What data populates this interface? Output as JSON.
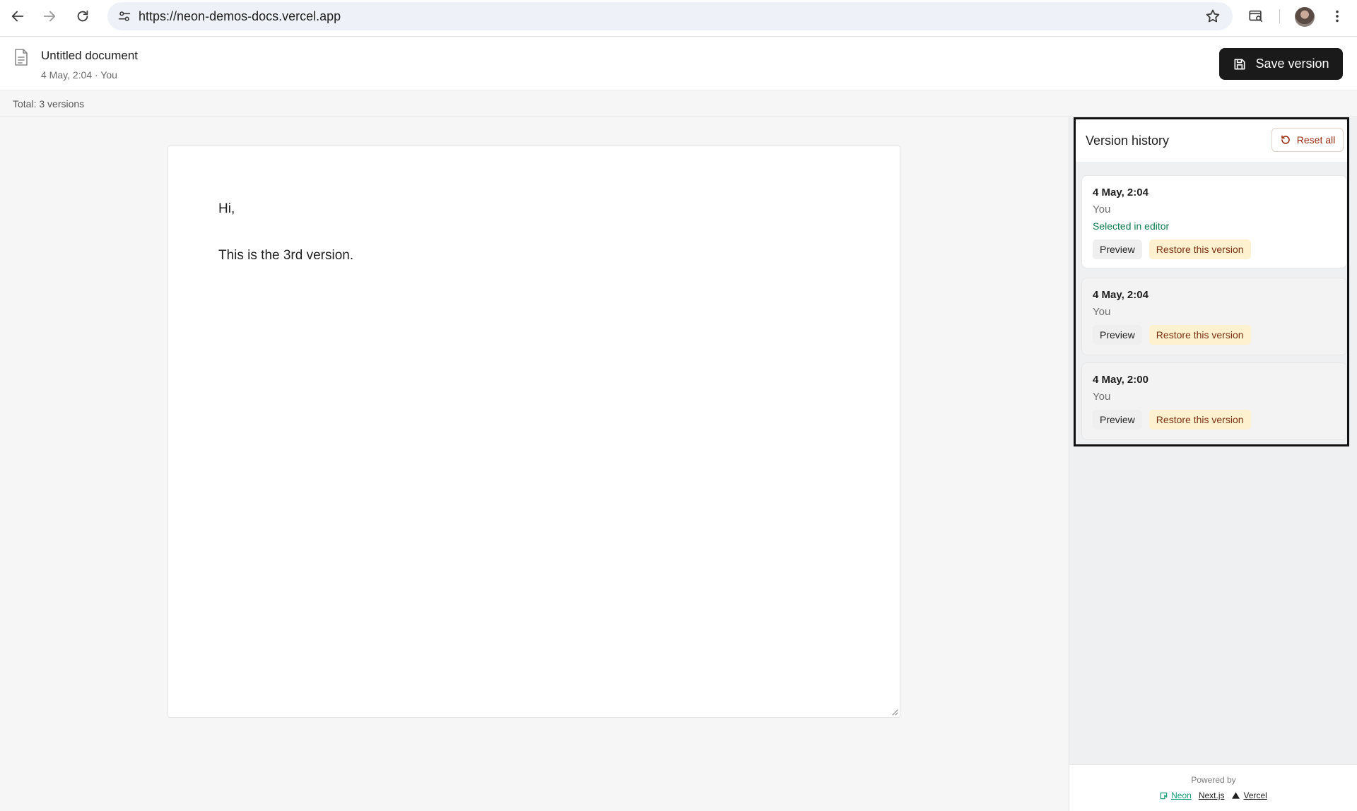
{
  "browser": {
    "url": "https://neon-demos-docs.vercel.app",
    "icons": [
      "back-arrow-icon",
      "forward-arrow-icon",
      "reload-icon",
      "site-settings-icon",
      "star-icon",
      "tab-search-icon",
      "avatar",
      "more-vert-icon"
    ]
  },
  "header": {
    "title": "Untitled document",
    "meta": "4 May, 2:04 · You",
    "save_label": "Save version"
  },
  "total": "Total: 3 versions",
  "editor": {
    "lines": [
      "Hi,",
      "This is the 3rd version."
    ]
  },
  "version_history": {
    "title": "Version history",
    "reset_label": "Reset all",
    "versions": [
      {
        "date": "4 May, 2:04",
        "user": "You",
        "status": "Selected in editor",
        "preview": "Preview",
        "restore": "Restore this version"
      },
      {
        "date": "4 May, 2:04",
        "user": "You",
        "preview": "Preview",
        "restore": "Restore this version"
      },
      {
        "date": "4 May, 2:00",
        "user": "You",
        "preview": "Preview",
        "restore": "Restore this version"
      }
    ]
  },
  "footer": {
    "powered": "Powered by",
    "links": [
      "Neon",
      "Next.js",
      "Vercel"
    ]
  },
  "colors": {
    "accent_dark": "#1a1a1a",
    "restore_bg": "#fdf1cf",
    "selected_green": "#0f7a4e",
    "neon_green": "#1a9c74"
  }
}
